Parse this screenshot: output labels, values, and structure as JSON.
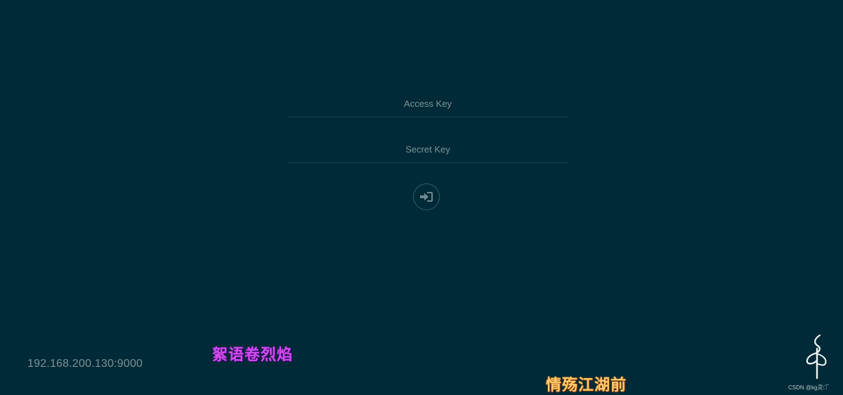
{
  "login": {
    "access_key_placeholder": "Access Key",
    "secret_key_placeholder": "Secret Key",
    "access_key_value": "",
    "secret_key_value": "",
    "submit_icon": "sign-in-icon"
  },
  "footer": {
    "server_address": "192.168.200.130:9000",
    "brand_icon": "minio-logo-icon"
  },
  "overlay": {
    "lyric_line_1": "絮语卷烈焰",
    "lyric_line_2": "情殇江湖前",
    "watermark": "CSDN @kg灵韵̅"
  },
  "colors": {
    "background": "#002a37",
    "input_underline": "#1a4350",
    "muted_text": "#7d9198",
    "lyric_1": "#d24cf0",
    "lyric_2": "#ffce6a"
  }
}
